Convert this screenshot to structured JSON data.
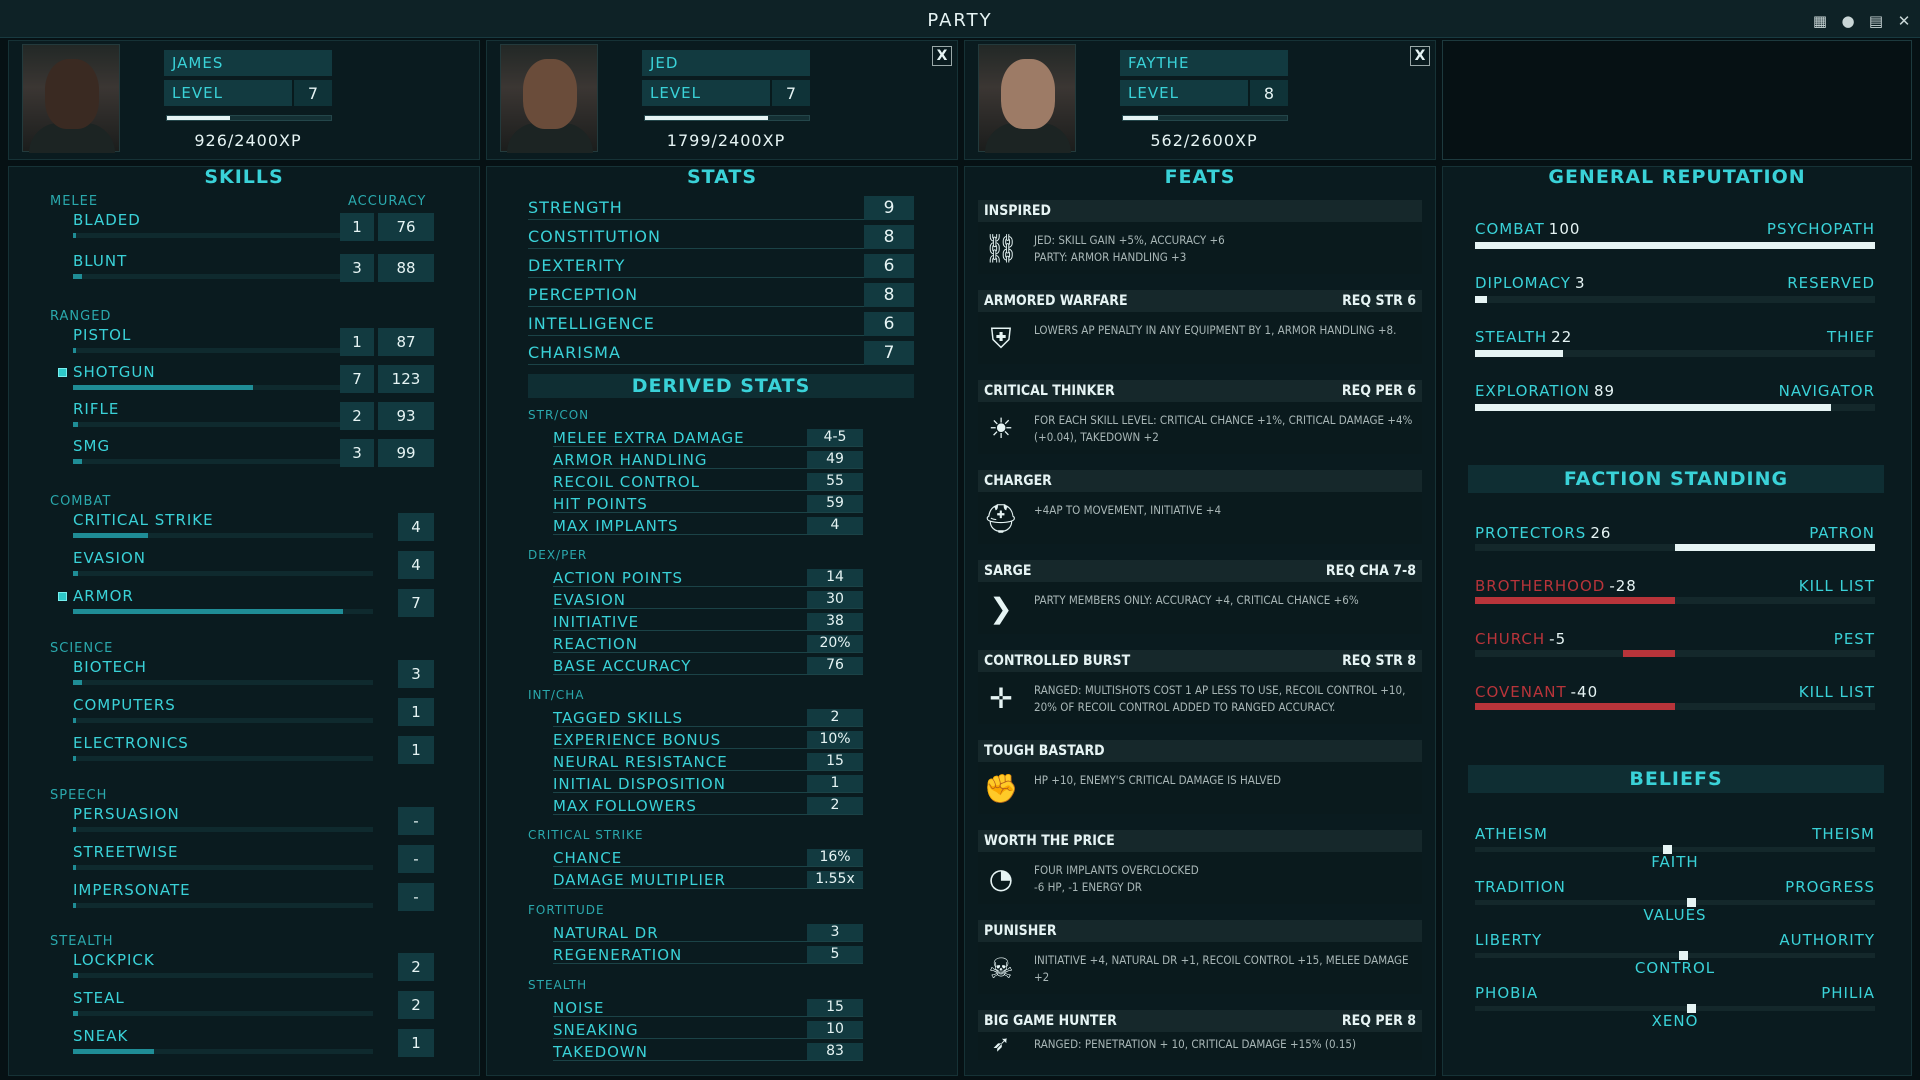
{
  "window": {
    "title": "PARTY"
  },
  "titlebar_icons": [
    "calendar-icon",
    "faction-icon",
    "codex-icon",
    "close-icon"
  ],
  "party": [
    {
      "name": "JAMES",
      "level_label": "LEVEL",
      "level": "7",
      "xp_text": "926/2400XP",
      "xp_fraction": 0.386,
      "skin": "#3a2a22"
    },
    {
      "name": "JED",
      "level_label": "LEVEL",
      "level": "7",
      "xp_text": "1799/2400XP",
      "xp_fraction": 0.75,
      "skin": "#6a4c3a",
      "close": "X"
    },
    {
      "name": "FAYTHE",
      "level_label": "LEVEL",
      "level": "8",
      "xp_text": "562/2600XP",
      "xp_fraction": 0.216,
      "skin": "#9d7b66",
      "close": "X"
    }
  ],
  "skills": {
    "title": "SKILLS",
    "accuracy_label": "ACCURACY",
    "categories": [
      {
        "name": "MELEE",
        "items": [
          {
            "name": "BLADED",
            "value": "1",
            "accuracy": "76",
            "progress": 0.0
          },
          {
            "name": "BLUNT",
            "value": "3",
            "accuracy": "88",
            "progress": 0.03
          }
        ]
      },
      {
        "name": "RANGED",
        "items": [
          {
            "name": "PISTOL",
            "value": "1",
            "accuracy": "87",
            "progress": 0.0
          },
          {
            "name": "SHOTGUN",
            "value": "7",
            "accuracy": "123",
            "progress": 0.6,
            "tagged": true
          },
          {
            "name": "RIFLE",
            "value": "2",
            "accuracy": "93",
            "progress": 0.01
          },
          {
            "name": "SMG",
            "value": "3",
            "accuracy": "99",
            "progress": 0.03
          }
        ]
      },
      {
        "name": "COMBAT",
        "items": [
          {
            "name": "CRITICAL STRIKE",
            "value": "4",
            "progress": 0.25
          },
          {
            "name": "EVASION",
            "value": "4",
            "progress": 0.01
          },
          {
            "name": "ARMOR",
            "value": "7",
            "progress": 0.9,
            "tagged": true
          }
        ]
      },
      {
        "name": "SCIENCE",
        "items": [
          {
            "name": "BIOTECH",
            "value": "3",
            "progress": 0.03
          },
          {
            "name": "COMPUTERS",
            "value": "1",
            "progress": 0.0
          },
          {
            "name": "ELECTRONICS",
            "value": "1",
            "progress": 0.0
          }
        ]
      },
      {
        "name": "SPEECH",
        "items": [
          {
            "name": "PERSUASION",
            "value": "-",
            "progress": 0.0
          },
          {
            "name": "STREETWISE",
            "value": "-",
            "progress": 0.0
          },
          {
            "name": "IMPERSONATE",
            "value": "-",
            "progress": 0.0
          }
        ]
      },
      {
        "name": "STEALTH",
        "items": [
          {
            "name": "LOCKPICK",
            "value": "2",
            "progress": 0.01
          },
          {
            "name": "STEAL",
            "value": "2",
            "progress": 0.01
          },
          {
            "name": "SNEAK",
            "value": "1",
            "progress": 0.27
          }
        ]
      }
    ]
  },
  "stats": {
    "title": "STATS",
    "items": [
      {
        "name": "STRENGTH",
        "value": "9"
      },
      {
        "name": "CONSTITUTION",
        "value": "8"
      },
      {
        "name": "DEXTERITY",
        "value": "6"
      },
      {
        "name": "PERCEPTION",
        "value": "8"
      },
      {
        "name": "INTELLIGENCE",
        "value": "6"
      },
      {
        "name": "CHARISMA",
        "value": "7"
      }
    ],
    "derived_title": "DERIVED STATS",
    "derived": [
      {
        "name": "STR/CON",
        "items": [
          {
            "name": "MELEE EXTRA DAMAGE",
            "value": "4-5"
          },
          {
            "name": "ARMOR HANDLING",
            "value": "49"
          },
          {
            "name": "RECOIL CONTROL",
            "value": "55"
          },
          {
            "name": "HIT POINTS",
            "value": "59"
          },
          {
            "name": "MAX IMPLANTS",
            "value": "4"
          }
        ]
      },
      {
        "name": "DEX/PER",
        "items": [
          {
            "name": "ACTION POINTS",
            "value": "14"
          },
          {
            "name": "EVASION",
            "value": "30"
          },
          {
            "name": "INITIATIVE",
            "value": "38"
          },
          {
            "name": "REACTION",
            "value": "20%"
          },
          {
            "name": "BASE ACCURACY",
            "value": "76"
          }
        ]
      },
      {
        "name": "INT/CHA",
        "items": [
          {
            "name": "TAGGED SKILLS",
            "value": "2"
          },
          {
            "name": "EXPERIENCE BONUS",
            "value": "10%"
          },
          {
            "name": "NEURAL RESISTANCE",
            "value": "15"
          },
          {
            "name": "INITIAL DISPOSITION",
            "value": "1"
          },
          {
            "name": "MAX FOLLOWERS",
            "value": "2"
          }
        ]
      },
      {
        "name": "CRITICAL STRIKE",
        "items": [
          {
            "name": "CHANCE",
            "value": "16%"
          },
          {
            "name": "DAMAGE MULTIPLIER",
            "value": "1.55x"
          }
        ]
      },
      {
        "name": "FORTITUDE",
        "items": [
          {
            "name": "NATURAL DR",
            "value": "3"
          },
          {
            "name": "REGENERATION",
            "value": "5"
          }
        ]
      },
      {
        "name": "STEALTH",
        "items": [
          {
            "name": "NOISE",
            "value": "15"
          },
          {
            "name": "SNEAKING",
            "value": "10"
          },
          {
            "name": "TAKEDOWN",
            "value": "83"
          }
        ]
      }
    ]
  },
  "feats": {
    "title": "FEATS",
    "items": [
      {
        "name": "INSPIRED",
        "req": "",
        "icon": "chain-link-icon",
        "glyph": "⛓",
        "desc": "JED: SKILL GAIN +5%, ACCURACY +6\nPARTY: ARMOR HANDLING +3"
      },
      {
        "name": "ARMORED WARFARE",
        "req": "REQ STR 6",
        "icon": "armor-vest-icon",
        "glyph": "⛨",
        "desc": "LOWERS AP PENALTY IN ANY EQUIPMENT BY 1, ARMOR HANDLING +8."
      },
      {
        "name": "CRITICAL THINKER",
        "req": "REQ PER 6",
        "icon": "lightbulb-icon",
        "glyph": "☀",
        "desc": "FOR EACH SKILL LEVEL: CRITICAL CHANCE +1%, CRITICAL DAMAGE +4% (+0.04), TAKEDOWN +2"
      },
      {
        "name": "CHARGER",
        "req": "",
        "icon": "helmet-icon",
        "glyph": "⛑",
        "desc": "+4AP TO MOVEMENT, INITIATIVE +4"
      },
      {
        "name": "SARGE",
        "req": "REQ CHA 7-8",
        "icon": "chevron-rank-icon",
        "glyph": "❯",
        "desc": "PARTY MEMBERS ONLY: ACCURACY +4, CRITICAL CHANCE +6%"
      },
      {
        "name": "CONTROLLED BURST",
        "req": "REQ STR 8",
        "icon": "crosshair-icon",
        "glyph": "✛",
        "desc": "RANGED: MULTISHOTS COST 1 AP LESS TO USE, RECOIL CONTROL +10, 20% OF RECOIL CONTROL ADDED TO RANGED ACCURACY."
      },
      {
        "name": "TOUGH BASTARD",
        "req": "",
        "icon": "fist-icon",
        "glyph": "✊",
        "desc": "HP +10, ENEMY'S CRITICAL DAMAGE IS HALVED"
      },
      {
        "name": "WORTH THE PRICE",
        "req": "",
        "icon": "gauge-icon",
        "glyph": "◔",
        "desc": "FOUR IMPLANTS OVERCLOCKED\n-6 HP, -1 ENERGY DR"
      },
      {
        "name": "PUNISHER",
        "req": "",
        "icon": "skull-icon",
        "glyph": "☠",
        "desc": "INITIATIVE +4, NATURAL DR +1, RECOIL CONTROL +15, MELEE DAMAGE +2"
      },
      {
        "name": "BIG GAME HUNTER",
        "req": "REQ PER 8",
        "icon": "rifle-icon",
        "glyph": "➶",
        "desc": "RANGED: PENETRATION + 10, CRITICAL DAMAGE +15% (0.15)"
      }
    ]
  },
  "reputation": {
    "title": "GENERAL REPUTATION",
    "items": [
      {
        "name": "COMBAT",
        "value": "100",
        "rank": "PSYCHOPATH",
        "fraction": 1.0
      },
      {
        "name": "DIPLOMACY",
        "value": "3",
        "rank": "RESERVED",
        "fraction": 0.03
      },
      {
        "name": "STEALTH",
        "value": "22",
        "rank": "THIEF",
        "fraction": 0.22
      },
      {
        "name": "EXPLORATION",
        "value": "89",
        "rank": "NAVIGATOR",
        "fraction": 0.89
      }
    ]
  },
  "factions": {
    "title": "FACTION STANDING",
    "items": [
      {
        "name": "PROTECTORS",
        "value": "26",
        "rank": "PATRON",
        "fraction": 0.5,
        "color": "#e6f4f4"
      },
      {
        "name": "BROTHERHOOD",
        "value": "-28",
        "rank": "KILL LIST",
        "fraction": -0.5,
        "color": "#b8343a"
      },
      {
        "name": "CHURCH",
        "value": "-5",
        "rank": "PEST",
        "fraction": -0.13,
        "color": "#b8343a"
      },
      {
        "name": "COVENANT",
        "value": "-40",
        "rank": "KILL LIST",
        "fraction": -0.5,
        "color": "#b8343a"
      }
    ]
  },
  "beliefs": {
    "title": "BELIEFS",
    "items": [
      {
        "left": "ATHEISM",
        "right": "THEISM",
        "center": "FAITH",
        "position": 0.48
      },
      {
        "left": "TRADITION",
        "right": "PROGRESS",
        "center": "VALUES",
        "position": 0.54
      },
      {
        "left": "LIBERTY",
        "right": "AUTHORITY",
        "center": "CONTROL",
        "position": 0.52
      },
      {
        "left": "PHOBIA",
        "right": "PHILIA",
        "center": "XENO",
        "position": 0.54
      }
    ]
  }
}
